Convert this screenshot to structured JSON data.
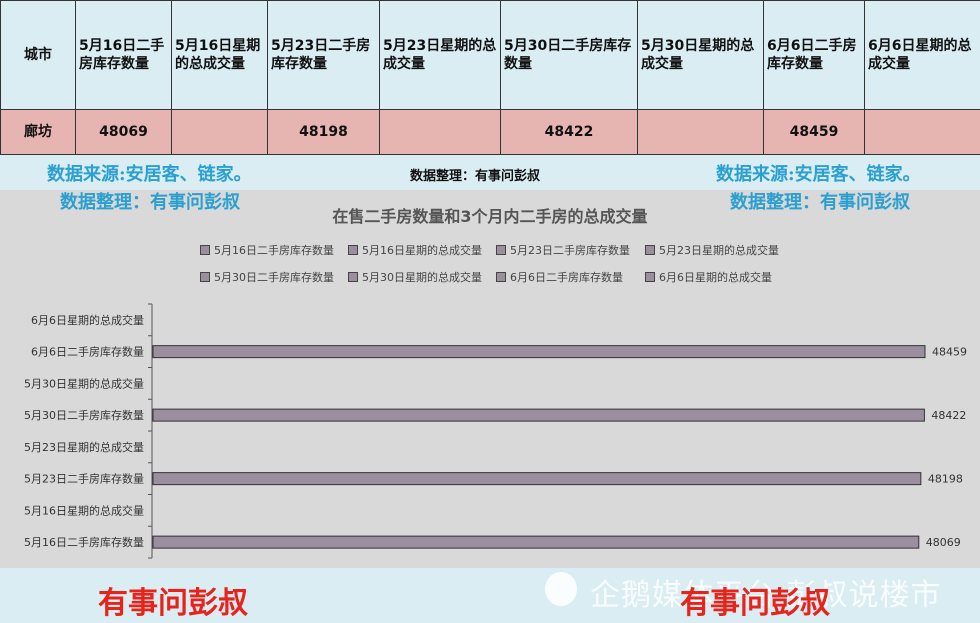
{
  "table": {
    "headers": [
      "城市",
      "5月16日二手房库存数量",
      "5月16日星期的总成交量",
      "5月23日二手房库存数量",
      "5月23日星期的总成交量",
      "5月30日二手房库存数量",
      "5月30日星期的总成交量",
      "6月6日二手房库存数量",
      "6月6日星期的总成交量"
    ],
    "row": [
      "廊坊",
      "48069",
      "",
      "48198",
      "",
      "48422",
      "",
      "48459",
      ""
    ]
  },
  "notes": {
    "source_left": "数据来源:安居客、链家。",
    "organizer_left": "数据整理：有事问彭叔",
    "organizer_mid": "数据整理：有事问彭叔",
    "source_right": "数据来源:安居客、链家。",
    "organizer_right": "数据整理：有事问彭叔"
  },
  "watermarks": {
    "red_left": "有事问彭叔",
    "red_right": "有事问彭叔",
    "platform": "企鹅媒体平台 彭叔说楼市"
  },
  "colors": {
    "bar": "#9b8e9e",
    "plot_bg": "#d9d9d9",
    "header_bg": "#daedf3",
    "row_bg": "#e6b5b2",
    "source_text": "#2ba0d0",
    "watermark_red": "#e8231b"
  },
  "chart_data": {
    "type": "bar",
    "orientation": "horizontal",
    "title": "在售二手房数量和3个月内二手房的总成交量",
    "categories": [
      "5月16日二手房库存数量",
      "5月16日星期的总成交量",
      "5月23日二手房库存数量",
      "5月23日星期的总成交量",
      "5月30日二手房库存数量",
      "5月30日星期的总成交量",
      "6月6日二手房库存数量",
      "6月6日星期的总成交量"
    ],
    "values": [
      48069,
      null,
      48198,
      null,
      48422,
      null,
      48459,
      null
    ],
    "legend": [
      "5月16日二手房库存数量",
      "5月16日星期的总成交量",
      "5月23日二手房库存数量",
      "5月23日星期的总成交量",
      "5月30日二手房库存数量",
      "5月30日星期的总成交量",
      "6月6日二手房库存数量",
      "6月6日星期的总成交量"
    ],
    "legend_position": "top",
    "grid": false
  }
}
